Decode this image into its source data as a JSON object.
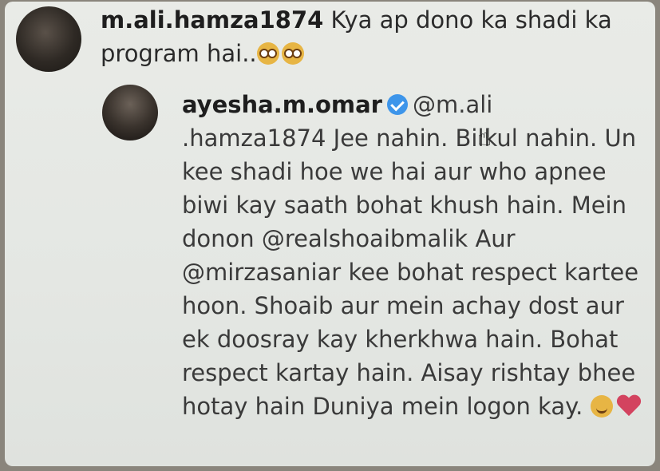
{
  "comment": {
    "username": "m.ali.hamza1874",
    "text": "Kya ap dono ka shadi ka program hai..",
    "emojis": [
      "flushed-face-icon",
      "flushed-face-icon"
    ]
  },
  "reply": {
    "username": "ayesha.m.omar",
    "verified": true,
    "mention_part1": "@m.ali",
    "mention_part2": ".hamza1874",
    "text": "Jee nahin. Bilkul nahin. Un kee shadi hoe we hai aur who apnee biwi kay saath bohat khush hain. Mein donon @realshoaibmalik Aur @mirzasaniar kee bohat respect kartee hoon. Shoaib aur mein achay dost aur ek doosray kay kherkhwa hain. Bohat respect kartay hain. Aisay rishtay bhee hotay hain Duniya mein logon kay.",
    "emojis": [
      "smiling-face-icon",
      "heart-icon"
    ]
  },
  "colors": {
    "verified": "#3d95ea",
    "heart": "#d3435f",
    "emoji": "#e7b544"
  }
}
